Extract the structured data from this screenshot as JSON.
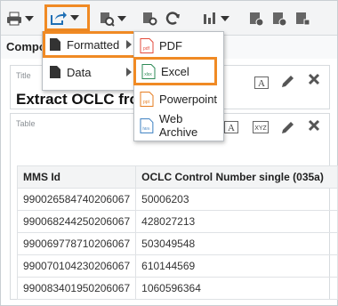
{
  "toolbar": {
    "icons": [
      "printer-icon",
      "export-icon",
      "preview-icon",
      "refresh-icon",
      "chart-icon",
      "report-properties-icon",
      "edit-icon"
    ]
  },
  "subbar": {
    "label": "Compo"
  },
  "export_menu": {
    "items": [
      {
        "label": "Formatted",
        "highlighted": true
      },
      {
        "label": "Data",
        "highlighted": false
      }
    ]
  },
  "format_menu": {
    "items": [
      {
        "label": "PDF",
        "icon_text": "pdf",
        "color": "#e34b3c"
      },
      {
        "label": "Excel",
        "icon_text": "xlsx",
        "color": "#2e8b57",
        "highlighted": true
      },
      {
        "label": "Powerpoint",
        "icon_text": "ppt",
        "color": "#e67e22"
      },
      {
        "label": "Web Archive",
        "icon_text": "htm",
        "color": "#3a7ec0"
      }
    ]
  },
  "title_panel": {
    "label": "Title",
    "text": "Extract OCLC fror"
  },
  "table_panel": {
    "label": "Table",
    "columns": [
      "MMS Id",
      "OCLC Control Number single (035a)"
    ],
    "rows": [
      [
        "990026584740206067",
        "50006203"
      ],
      [
        "990068244250206067",
        "428027213"
      ],
      [
        "990069778710206067",
        "503049548"
      ],
      [
        "990070104230206067",
        "610144569"
      ],
      [
        "990083401950206067",
        "1060596364"
      ]
    ]
  },
  "colors": {
    "highlight": "#f08a24",
    "accent": "#1f6fb5"
  }
}
